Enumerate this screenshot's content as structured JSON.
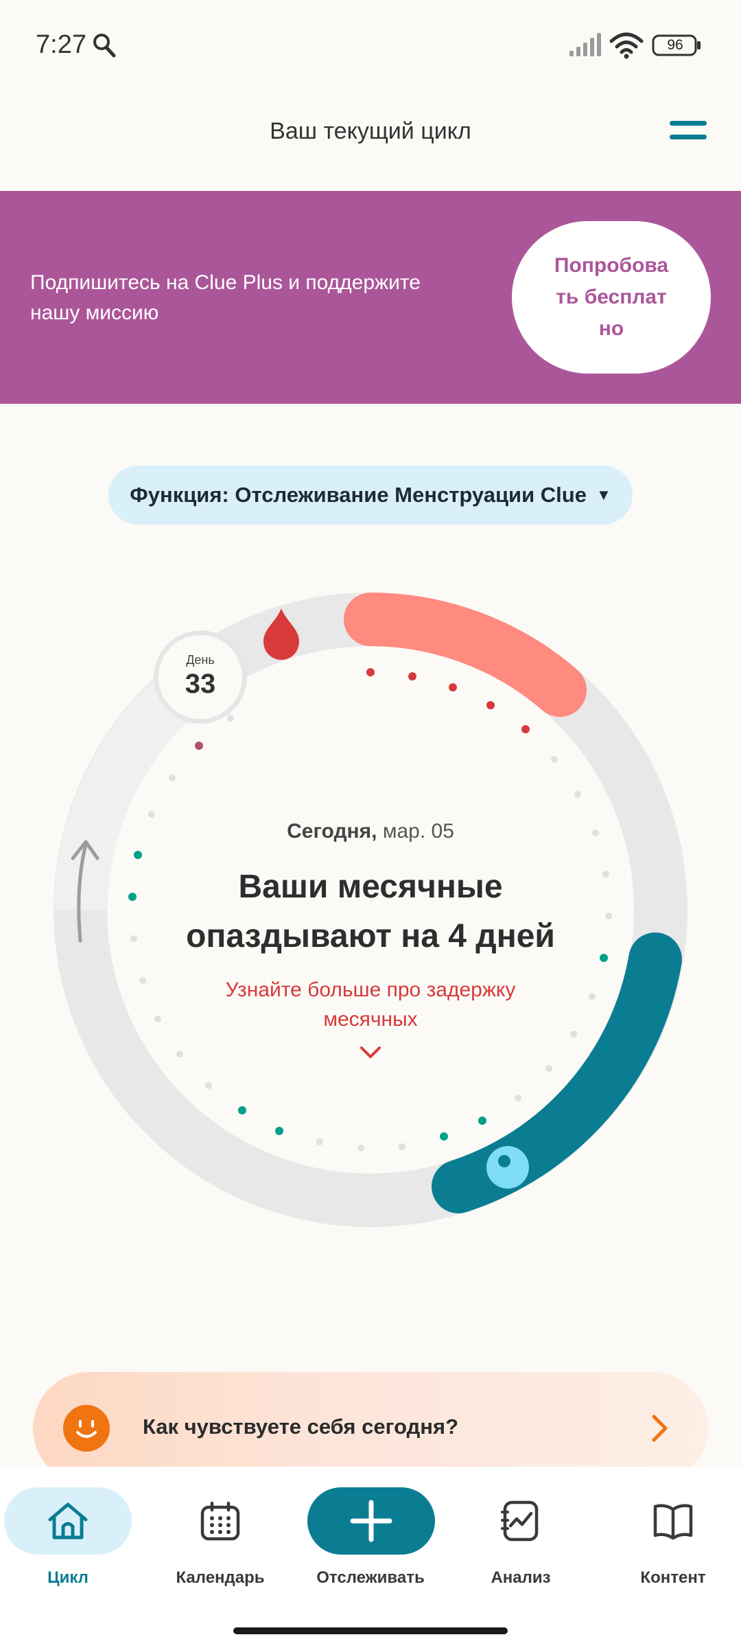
{
  "status_bar": {
    "time": "7:27",
    "battery": "96"
  },
  "header": {
    "title": "Ваш текущий цикл"
  },
  "promo": {
    "text": "Подпишитесь на Clue Plus и поддержите нашу миссию",
    "button_label": "Попробовать бесплатно"
  },
  "feature": {
    "label": "Функция: Отслеживание Менструации Clue"
  },
  "cycle": {
    "day_label": "День",
    "day_number": "33",
    "date_prefix": "Сегодня,",
    "date_value": "мар. 05",
    "headline": "Ваши месячные опаздывают на 4 дней",
    "learn_more": "Узнайте больше про задержку месячных"
  },
  "mood": {
    "question": "Как чувствуете себя сегодня?"
  },
  "nav": {
    "items": [
      {
        "label": "Цикл"
      },
      {
        "label": "Календарь"
      },
      {
        "label": "Отслеживать"
      },
      {
        "label": "Анализ"
      },
      {
        "label": "Контент"
      }
    ]
  },
  "colors": {
    "brand": "#0B7D93",
    "promo": "#AC569A",
    "period": "#FF8A80",
    "period_dot": "#D63A3A",
    "fertile": "#00A08A",
    "ovulation": "#7FDDF5",
    "mood": "#F07412"
  },
  "icons": {
    "search": "search-icon",
    "menu": "hamburger-menu-icon",
    "blood_drop": "blood-drop-icon",
    "home": "home-icon",
    "calendar": "calendar-icon",
    "plus": "plus-icon",
    "analysis": "analysis-icon",
    "content": "book-icon"
  }
}
